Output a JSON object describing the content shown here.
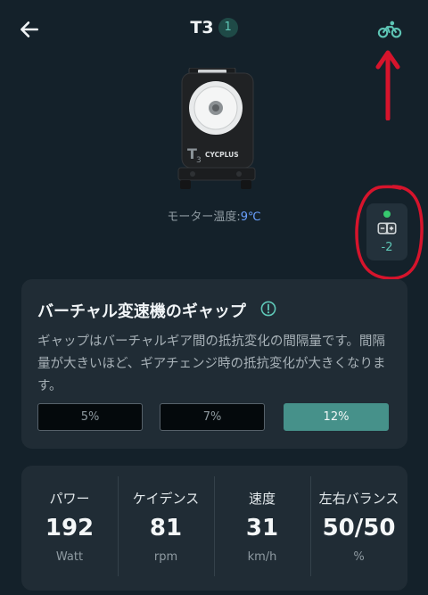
{
  "header": {
    "title": "T3",
    "device_count": "1",
    "icons": {
      "back": "back-arrow-icon",
      "bike": "bike-icon"
    }
  },
  "device": {
    "brand_text": "T3 CYCPLUS",
    "temperature_label": "モーター温度:",
    "temperature_value": "9℃"
  },
  "gear": {
    "status": "connected",
    "status_color": "#37c96f",
    "value": "-2"
  },
  "gap_card": {
    "title": "バーチャル変速機のギャップ",
    "description": "ギャップはバーチャルギア間の抵抗変化の間隔量です。間隔量が大きいほど、ギアチェンジ時の抵抗変化が大きくなります。",
    "options": [
      {
        "label": "5%",
        "selected": false
      },
      {
        "label": "7%",
        "selected": false
      },
      {
        "label": "12%",
        "selected": true
      }
    ],
    "accent_color": "#46918a"
  },
  "stats": [
    {
      "label": "パワー",
      "value": "192",
      "unit": "Watt"
    },
    {
      "label": "ケイデンス",
      "value": "81",
      "unit": "rpm"
    },
    {
      "label": "速度",
      "value": "31",
      "unit": "km/h"
    },
    {
      "label": "左右バランス",
      "value": "50/50",
      "unit": "%"
    }
  ],
  "colors": {
    "background": "#14212a",
    "card": "#202c35",
    "accent": "#5ec6b6",
    "annotation": "#d6142c"
  }
}
